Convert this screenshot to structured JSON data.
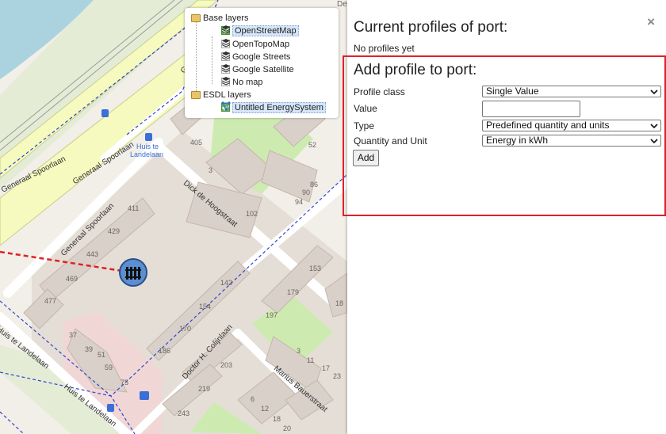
{
  "map": {
    "street_labels": [
      "Generaal Spoorlaan",
      "Generaal Spoorlaan",
      "Generaal Spoorlaan",
      "Dick de Hoogstraat",
      "Doctor H. Colijnlaan",
      "Marius Bauerstraat",
      "Huis te Landelaan",
      "Huis te Landelaan",
      "Ge"
    ],
    "bus_stop_label": [
      "Huis te",
      "Landelaan"
    ],
    "house_numbers": [
      "405",
      "52",
      "3",
      "86",
      "90",
      "94",
      "102",
      "411",
      "429",
      "443",
      "469",
      "477",
      "153",
      "142",
      "179",
      "154",
      "18",
      "197",
      "170",
      "186",
      "37",
      "39",
      "51",
      "59",
      "75",
      "203",
      "219",
      "243",
      "3",
      "11",
      "17",
      "23",
      "6",
      "12",
      "18",
      "20",
      "De"
    ],
    "asset_icon": "heater-icon"
  },
  "layers": {
    "base_group": "Base layers",
    "base_items": [
      "OpenStreetMap",
      "OpenTopoMap",
      "Google Streets",
      "Google Satellite",
      "No map"
    ],
    "esdl_group": "ESDL layers",
    "esdl_items": [
      "Untitled EnergySystem"
    ]
  },
  "panel": {
    "close_symbol": "×",
    "current_title": "Current profiles of port:",
    "no_profiles": "No profiles yet",
    "add_title": "Add profile to port:",
    "profile_class_label": "Profile class",
    "profile_class_value": "Single Value",
    "value_label": "Value",
    "value_input": "",
    "type_label": "Type",
    "type_value": "Predefined quantity and units",
    "qu_label": "Quantity and Unit",
    "qu_value": "Energy in kWh",
    "add_button": "Add"
  },
  "colors": {
    "highlight_border": "#e0202a",
    "map_bg": "#f2efe9",
    "water": "#aad3df",
    "park": "#cdebb0",
    "trunk_road": "#f6fabe"
  }
}
